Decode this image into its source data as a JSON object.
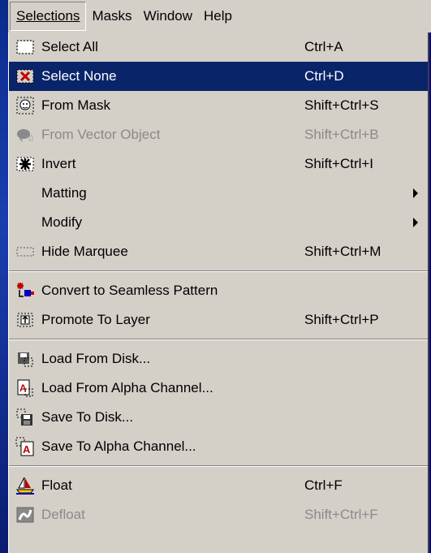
{
  "menubar": {
    "items": [
      {
        "label": "Selections",
        "open": true
      },
      {
        "label": "Masks"
      },
      {
        "label": "Window"
      },
      {
        "label": "Help"
      }
    ]
  },
  "menu": {
    "items": [
      {
        "label": "Select All",
        "shortcut": "Ctrl+A",
        "icon": "select-all-icon"
      },
      {
        "label": "Select None",
        "shortcut": "Ctrl+D",
        "icon": "select-none-icon",
        "selected": true
      },
      {
        "label": "From Mask",
        "shortcut": "Shift+Ctrl+S",
        "icon": "from-mask-icon"
      },
      {
        "label": "From Vector Object",
        "shortcut": "Shift+Ctrl+B",
        "icon": "from-vector-object-icon",
        "disabled": true
      },
      {
        "label": "Invert",
        "shortcut": "Shift+Ctrl+I",
        "icon": "invert-icon"
      },
      {
        "label": "Matting",
        "shortcut": "",
        "submenu": true
      },
      {
        "label": "Modify",
        "shortcut": "",
        "submenu": true
      },
      {
        "label": "Hide Marquee",
        "shortcut": "Shift+Ctrl+M",
        "icon": "hide-marquee-icon"
      },
      {
        "label": "Convert to Seamless Pattern",
        "shortcut": "",
        "icon": "seamless-pattern-icon"
      },
      {
        "label": "Promote To Layer",
        "shortcut": "Shift+Ctrl+P",
        "icon": "promote-to-layer-icon"
      },
      {
        "label": "Load From Disk...",
        "shortcut": "",
        "icon": "load-from-disk-icon"
      },
      {
        "label": "Load From Alpha Channel...",
        "shortcut": "",
        "icon": "load-alpha-icon"
      },
      {
        "label": "Save To Disk...",
        "shortcut": "",
        "icon": "save-to-disk-icon"
      },
      {
        "label": "Save To Alpha Channel...",
        "shortcut": "",
        "icon": "save-alpha-icon"
      },
      {
        "label": "Float",
        "shortcut": "Ctrl+F",
        "icon": "float-icon"
      },
      {
        "label": "Defloat",
        "shortcut": "Shift+Ctrl+F",
        "icon": "defloat-icon",
        "disabled": true
      }
    ]
  },
  "colors": {
    "menu_bg": "#d4d0c8",
    "highlight": "#0a246a",
    "desktop": "#0000a0"
  }
}
